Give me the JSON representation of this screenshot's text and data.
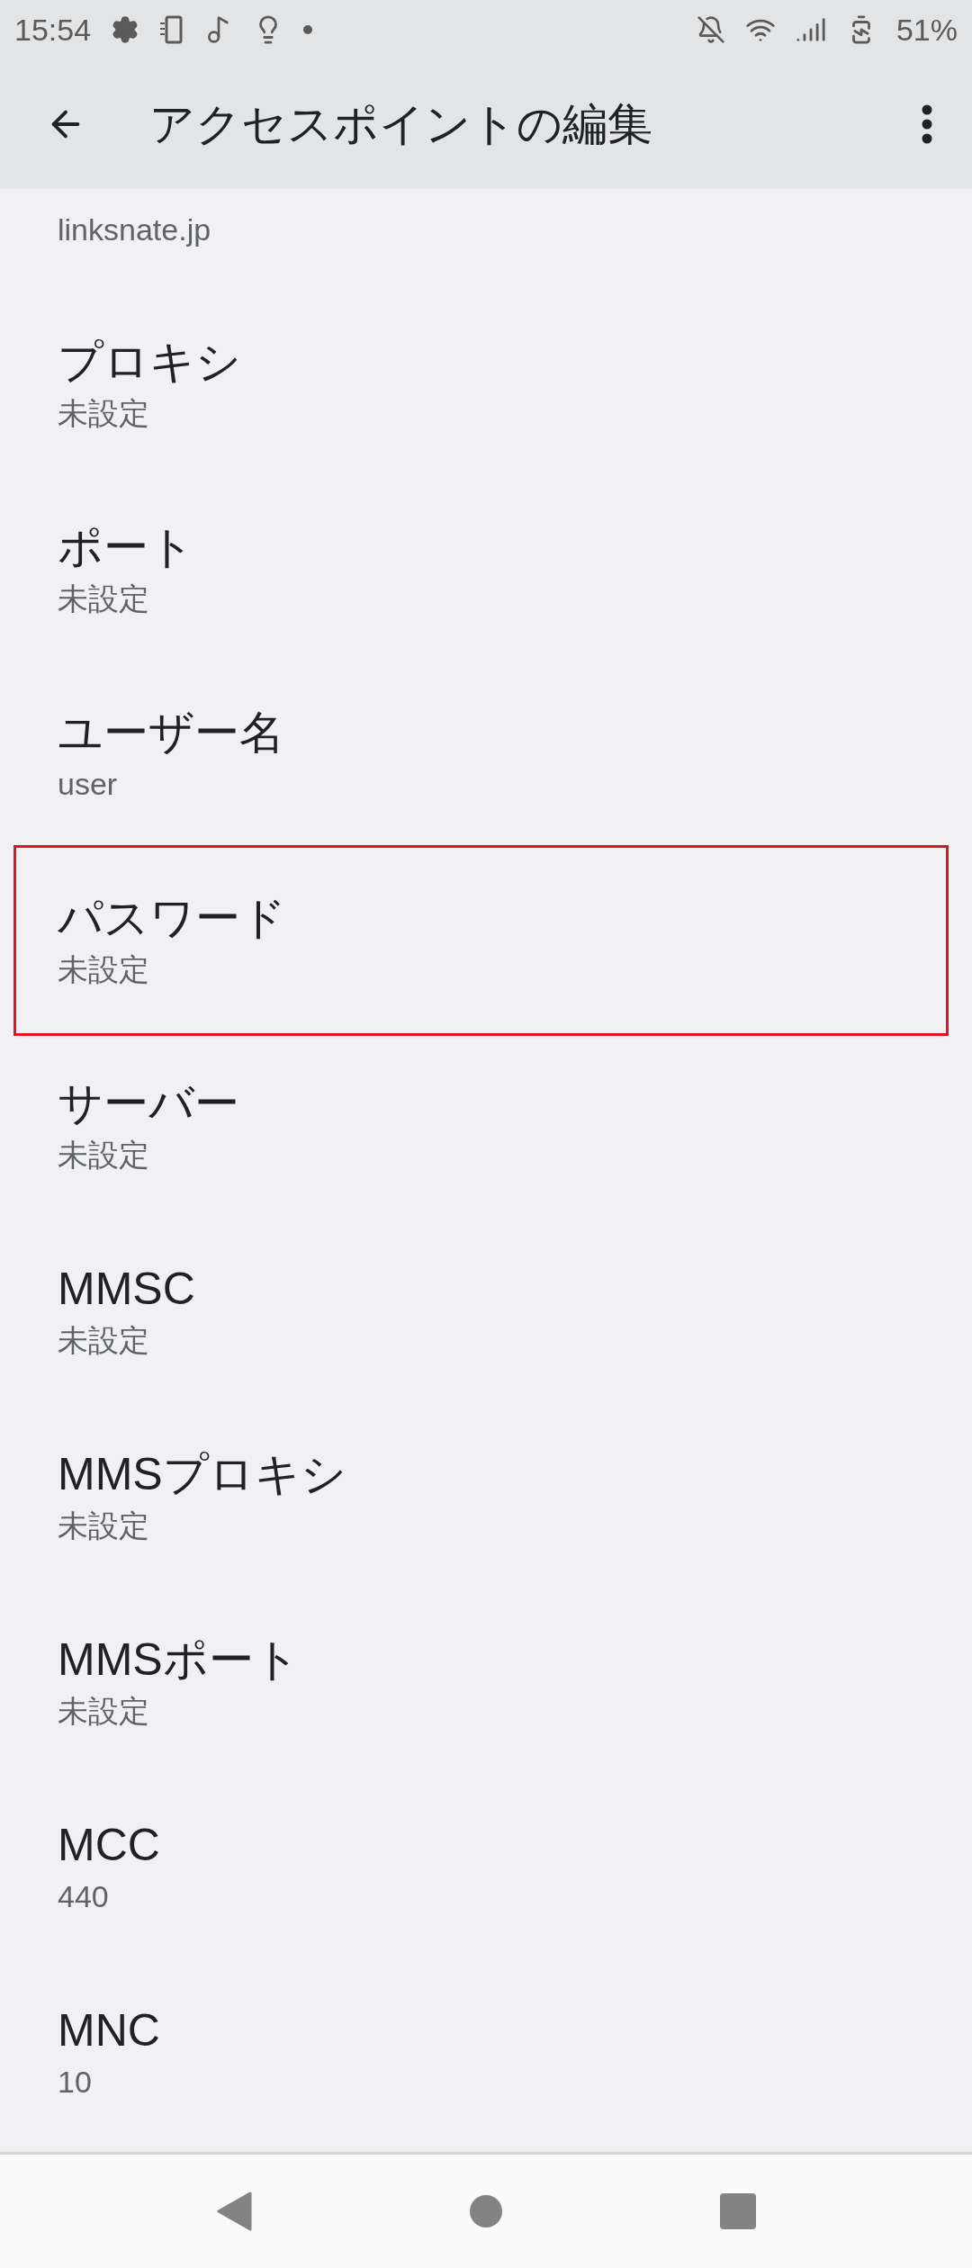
{
  "status_bar": {
    "time": "15:54",
    "battery": "51%"
  },
  "app_bar": {
    "title": "アクセスポイントの編集"
  },
  "items": [
    {
      "value": "linksnate.jp",
      "highlighted": false
    },
    {
      "title": "プロキシ",
      "value": "未設定",
      "highlighted": false
    },
    {
      "title": "ポート",
      "value": "未設定",
      "highlighted": false
    },
    {
      "title": "ユーザー名",
      "value": "user",
      "highlighted": false
    },
    {
      "title": "パスワード",
      "value": "未設定",
      "highlighted": true
    },
    {
      "title": "サーバー",
      "value": "未設定",
      "highlighted": false
    },
    {
      "title": "MMSC",
      "value": "未設定",
      "highlighted": false
    },
    {
      "title": "MMSプロキシ",
      "value": "未設定",
      "highlighted": false
    },
    {
      "title": "MMSポート",
      "value": "未設定",
      "highlighted": false
    },
    {
      "title": "MCC",
      "value": "440",
      "highlighted": false
    },
    {
      "title": "MNC",
      "value": "10",
      "highlighted": false
    }
  ]
}
